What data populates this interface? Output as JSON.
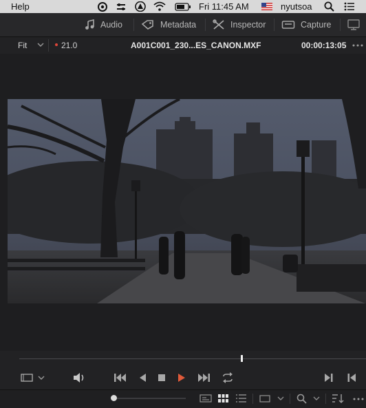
{
  "menubar": {
    "app_menu": "Help",
    "clock": "Fri 11:45 AM",
    "user": "nyutsoa"
  },
  "toolbar": {
    "audio_label": "Audio",
    "metadata_label": "Metadata",
    "inspector_label": "Inspector",
    "capture_label": "Capture"
  },
  "viewer": {
    "zoom": "Fit",
    "zoom_level": "21.0",
    "clip_name": "A001C001_230...ES_CANON.MXF",
    "timecode": "00:00:13:05"
  },
  "playback": {
    "playhead_fraction": 0.64
  },
  "colors": {
    "accent": "#e05a3a",
    "record_dot": "#e0463a"
  }
}
